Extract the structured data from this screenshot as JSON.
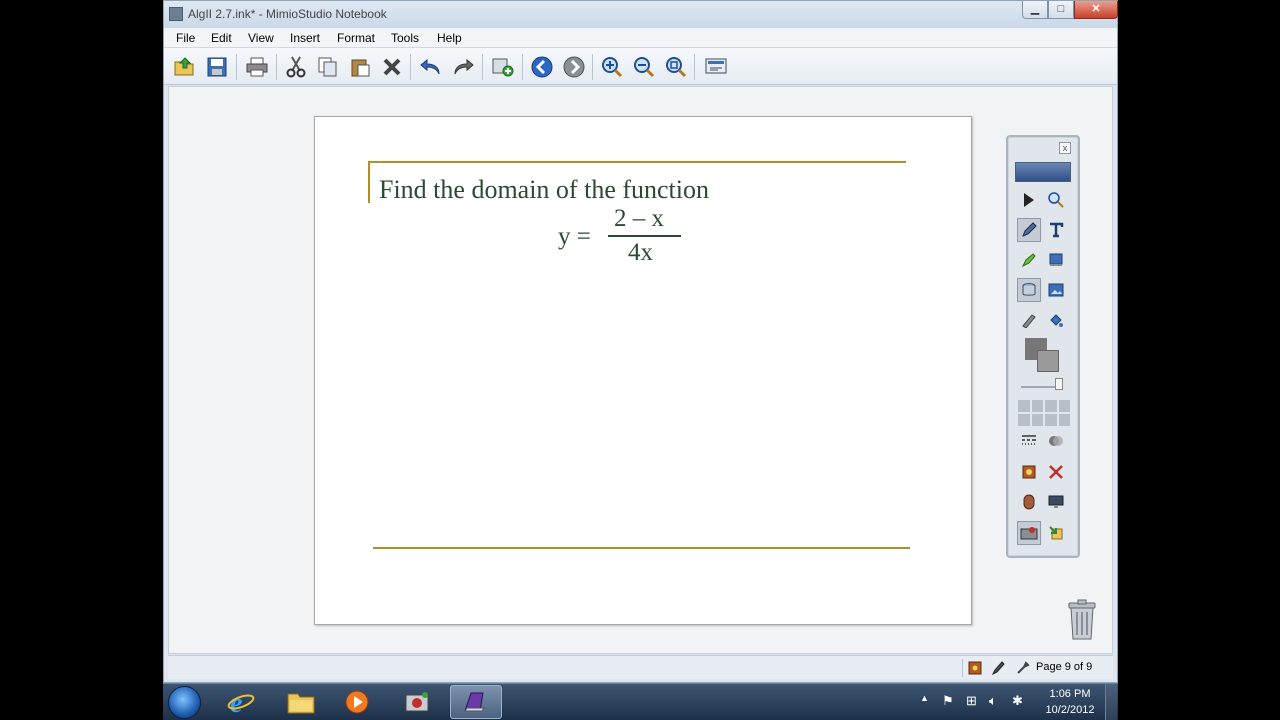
{
  "window": {
    "title": "AlgII 2.7.ink* - MimioStudio Notebook",
    "controls": {
      "minimize": "▁",
      "maximize": "□",
      "close": "✕"
    }
  },
  "menu": {
    "file": "File",
    "edit": "Edit",
    "view": "View",
    "insert": "Insert",
    "format": "Format",
    "tools": "Tools",
    "help": "Help"
  },
  "toolbar_icons": [
    "open-icon",
    "save-icon",
    "print-icon",
    "cut-icon",
    "copy-icon",
    "paste-icon",
    "delete-icon",
    "undo-icon",
    "redo-icon",
    "new-page-icon",
    "back-icon",
    "forward-icon",
    "zoom-in-icon",
    "zoom-out-icon",
    "zoom-fit-icon",
    "display-icon"
  ],
  "page": {
    "heading": "Find the domain of the function",
    "equation": {
      "lhs": "y =",
      "numerator": "2 – x",
      "denominator": "4x"
    },
    "rule_color": "#b08e2a",
    "text_color": "#2c4a32"
  },
  "palette": {
    "close": "x",
    "tools": [
      "select-icon",
      "zoom-icon",
      "pen-icon",
      "text-icon",
      "highlighter-icon",
      "shape-icon",
      "spotlight-icon",
      "image-icon",
      "eraser-icon",
      "fill-icon",
      "line-style-icon",
      "transparency-icon",
      "recorder-icon",
      "clear-icon",
      "mouse-icon",
      "screen-icon",
      "capture-icon",
      "import-icon"
    ],
    "foreground_color": "#777777",
    "background_color": "#9a9a9a"
  },
  "status": {
    "page_indicator": "Page 9 of 9"
  },
  "taskbar": {
    "apps": [
      "internet-explorer-icon",
      "file-explorer-icon",
      "media-player-icon",
      "capture-app-icon",
      "mimio-notebook-icon"
    ],
    "clock_time": "1:06 PM",
    "clock_date": "10/2/2012"
  }
}
